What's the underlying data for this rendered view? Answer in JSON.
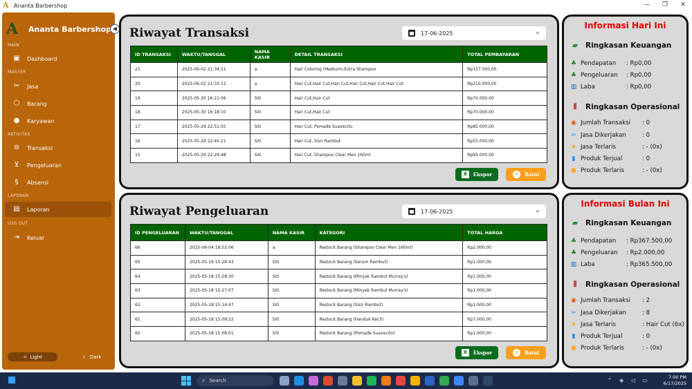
{
  "window": {
    "title": "Ananta Barbershop",
    "controls": [
      "—",
      "❐",
      "✕"
    ]
  },
  "sidebar": {
    "brand": "Ananta Barbershop",
    "logo_letter": "A",
    "collapse_glyph": "◀",
    "sections": {
      "main": "MAIN",
      "master": "MASTER",
      "aktivitas": "AKTIVITAS",
      "laporan": "LAPORAN",
      "logout": "LOG OUT"
    },
    "items": [
      {
        "label": "Dashboard",
        "icon": "dashboard-icon"
      },
      {
        "label": "Jasa",
        "icon": "service-icon"
      },
      {
        "label": "Barang",
        "icon": "box-icon"
      },
      {
        "label": "Karyawan",
        "icon": "user-icon"
      },
      {
        "label": "Transaksi",
        "icon": "transaction-icon"
      },
      {
        "label": "Pengeluaran",
        "icon": "cart-icon"
      },
      {
        "label": "Absensi",
        "icon": "attendance-icon"
      },
      {
        "label": "Laporan",
        "icon": "report-icon"
      },
      {
        "label": "Keluar",
        "icon": "logout-icon"
      }
    ],
    "active_item": "Laporan",
    "theme": {
      "light": "Light",
      "dark": "Dark"
    }
  },
  "transactions": {
    "title": "Riwayat Transaksi",
    "date": "17-06-2025",
    "columns": [
      "ID TRANSAKSI",
      "WAKTU/TANGGAL",
      "NAMA KASIR",
      "DETAIL TRANSAKSI",
      "TOTAL PEMBAYARAN"
    ],
    "rows": [
      [
        "21",
        "2025-06-02 21:34:11",
        "a",
        "Hair Coloring (Medium),Extra Shampoo",
        "Rp157.500,00"
      ],
      [
        "20",
        "2025-06-02 21:33:12",
        "a",
        "Hair Cut,Hair Cut,Hair Cut,Hair Cut,Hair Cut,Hair Cut",
        "Rp210.000,00"
      ],
      [
        "19",
        "2025-05-30 16:21:06",
        "Siti",
        "Hair Cut,Hair Cut",
        "Rp70.000,00"
      ],
      [
        "18",
        "2025-05-30 16:18:10",
        "Siti",
        "Hair Cut,Hair Cut",
        "Rp70.000,00"
      ],
      [
        "17",
        "2025-05-29 22:51:55",
        "Siti",
        "Hair Cut, Pomade Suavecito",
        "Rp85.000,00"
      ],
      [
        "16",
        "2025-05-29 22:45:21",
        "Siti",
        "Hair Cut, Sisir Rambut",
        "Rp55.000,00"
      ],
      [
        "15",
        "2025-05-29 22:29:48",
        "Siti",
        "Hair Cut, Shampoo Clear Men 160ml",
        "Rp95.000,00"
      ]
    ],
    "export_label": "Ekspor",
    "cancel_label": "Batal"
  },
  "expenses": {
    "title": "Riwayat Pengeluaran",
    "date": "17-06-2025",
    "columns": [
      "ID PENGELUARAN",
      "WAKTU/TANGGAL",
      "NAMA KASIR",
      "KATEGORI",
      "TOTAL HARGA"
    ],
    "rows": [
      [
        "66",
        "2025-06-04 18:52:06",
        "a",
        "Restock Barang (Shampoo Clear Men 160ml)",
        "Rp2.000,00"
      ],
      [
        "65",
        "2025-05-18 15:28:43",
        "Siti",
        "Restock Barang (Serum Rambut)",
        "Rp1.000,00"
      ],
      [
        "64",
        "2025-05-18 15:28:30",
        "Siti",
        "Restock Barang (Minyak Rambut Murray's)",
        "Rp1.000,00"
      ],
      [
        "63",
        "2025-05-18 15:27:07",
        "Siti",
        "Restock Barang (Minyak Rambut Murray's)",
        "Rp1.000,00"
      ],
      [
        "62",
        "2025-05-18 15:14:47",
        "Siti",
        "Restock Barang (Sisir Rambut)",
        "Rp1.000,00"
      ],
      [
        "61",
        "2025-05-18 15:09:22",
        "Siti",
        "Restock Barang (Handuk Kecil)",
        "Rp7.000,00"
      ],
      [
        "60",
        "2025-05-18 15:08:01",
        "Siti",
        "Restock Barang (Pomade Suavecito)",
        "Rp1.000,00"
      ]
    ],
    "export_label": "Ekspor",
    "cancel_label": "Batal"
  },
  "info_today": {
    "title": "Informasi Hari Ini",
    "finance_title": "Ringkasan Keuangan",
    "finance": [
      {
        "label": "Pendapatan",
        "value": ": Rp0,00"
      },
      {
        "label": "Pengeluaran",
        "value": ": Rp0,00"
      },
      {
        "label": "Laba",
        "value": ": Rp0,00"
      }
    ],
    "ops_title": "Ringkasan Operasional",
    "ops": [
      {
        "label": "Jumlah Transaksi",
        "value": ": 0"
      },
      {
        "label": "Jasa Dikerjakan",
        "value": ": 0"
      },
      {
        "label": "Jasa Terlaris",
        "value": ": - (0x)"
      },
      {
        "label": "Produk Terjual",
        "value": ": 0"
      },
      {
        "label": "Produk Terlaris",
        "value": ": - (0x)"
      }
    ]
  },
  "info_month": {
    "title": "Informasi Bulan Ini",
    "finance_title": "Ringkasan Keuangan",
    "finance": [
      {
        "label": "Pendapatan",
        "value": ": Rp367.500,00"
      },
      {
        "label": "Pengeluaran",
        "value": ": Rp2.000,00"
      },
      {
        "label": "Laba",
        "value": ": Rp365.500,00"
      }
    ],
    "ops_title": "Ringkasan Operasional",
    "ops": [
      {
        "label": "Jumlah Transaksi",
        "value": ": 2"
      },
      {
        "label": "Jasa Dikerjakan",
        "value": ": 8"
      },
      {
        "label": "Jasa Terlaris",
        "value": ": Hair Cut (6x)"
      },
      {
        "label": "Produk Terjual",
        "value": ": 0"
      },
      {
        "label": "Produk Terlaris",
        "value": ": - (0x)"
      }
    ]
  },
  "taskbar": {
    "search_placeholder": "Search",
    "time": "7:00 PM",
    "date": "6/17/2025",
    "tray": "⌃ ◈ ◁ ▭"
  },
  "colors": {
    "sidebar": "#b9650a",
    "header_green": "#006400",
    "accent_red": "#e00000",
    "export_green": "#0a6b1f",
    "cancel_orange": "#f8a01e"
  }
}
